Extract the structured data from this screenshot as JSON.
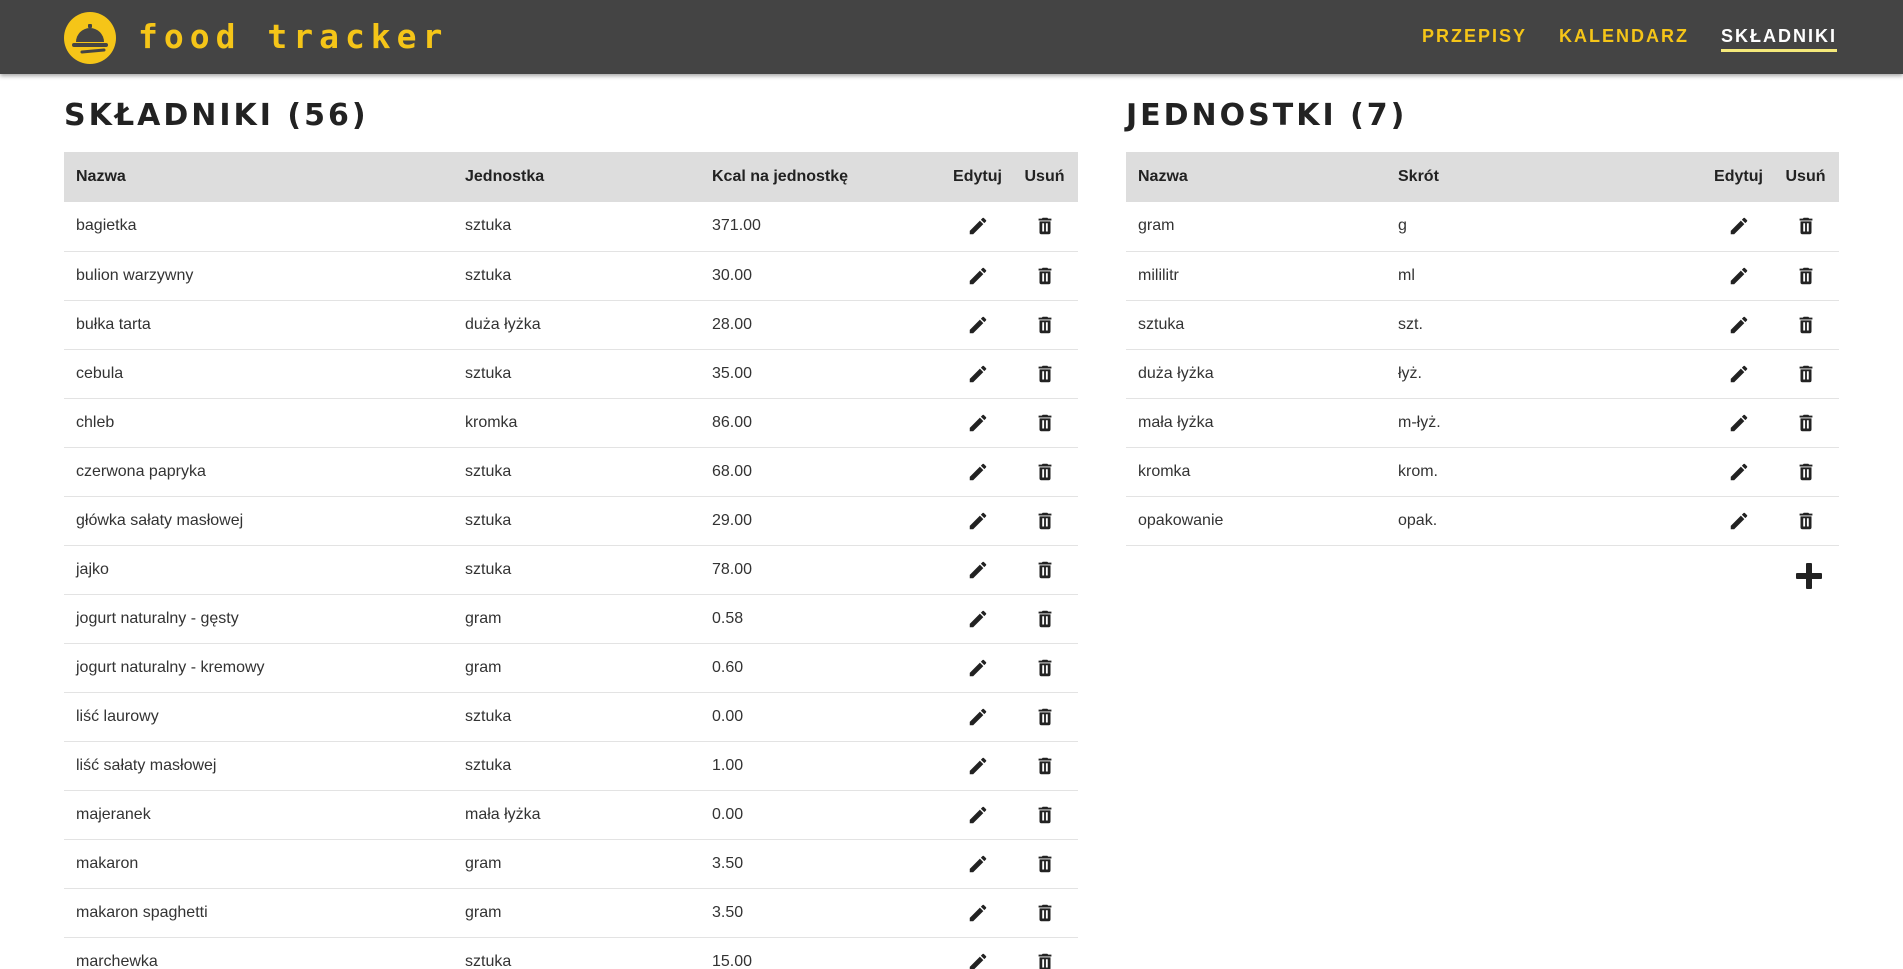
{
  "app": {
    "brand": "food tracker"
  },
  "nav": {
    "items": [
      {
        "label": "PRZEPISY",
        "active": false
      },
      {
        "label": "KALENDARZ",
        "active": false
      },
      {
        "label": "SKŁADNIKI",
        "active": true
      }
    ]
  },
  "ingredients": {
    "title": "SKŁADNIKI (56)",
    "headers": {
      "name": "Nazwa",
      "unit": "Jednostka",
      "kcal": "Kcal na jednostkę",
      "edit": "Edytuj",
      "delete": "Usuń"
    },
    "rows": [
      {
        "name": "bagietka",
        "unit": "sztuka",
        "kcal": "371.00"
      },
      {
        "name": "bulion warzywny",
        "unit": "sztuka",
        "kcal": "30.00"
      },
      {
        "name": "bułka tarta",
        "unit": "duża łyżka",
        "kcal": "28.00"
      },
      {
        "name": "cebula",
        "unit": "sztuka",
        "kcal": "35.00"
      },
      {
        "name": "chleb",
        "unit": "kromka",
        "kcal": "86.00"
      },
      {
        "name": "czerwona papryka",
        "unit": "sztuka",
        "kcal": "68.00"
      },
      {
        "name": "główka sałaty masłowej",
        "unit": "sztuka",
        "kcal": "29.00"
      },
      {
        "name": "jajko",
        "unit": "sztuka",
        "kcal": "78.00"
      },
      {
        "name": "jogurt naturalny - gęsty",
        "unit": "gram",
        "kcal": "0.58"
      },
      {
        "name": "jogurt naturalny - kremowy",
        "unit": "gram",
        "kcal": "0.60"
      },
      {
        "name": "liść laurowy",
        "unit": "sztuka",
        "kcal": "0.00"
      },
      {
        "name": "liść sałaty masłowej",
        "unit": "sztuka",
        "kcal": "1.00"
      },
      {
        "name": "majeranek",
        "unit": "mała łyżka",
        "kcal": "0.00"
      },
      {
        "name": "makaron",
        "unit": "gram",
        "kcal": "3.50"
      },
      {
        "name": "makaron spaghetti",
        "unit": "gram",
        "kcal": "3.50"
      },
      {
        "name": "marchewka",
        "unit": "sztuka",
        "kcal": "15.00"
      }
    ]
  },
  "units": {
    "title": "JEDNOSTKI (7)",
    "headers": {
      "name": "Nazwa",
      "short": "Skrót",
      "edit": "Edytuj",
      "delete": "Usuń"
    },
    "rows": [
      {
        "name": "gram",
        "short": "g"
      },
      {
        "name": "mililitr",
        "short": "ml"
      },
      {
        "name": "sztuka",
        "short": "szt."
      },
      {
        "name": "duża łyżka",
        "short": "łyż."
      },
      {
        "name": "mała łyżka",
        "short": "m-łyż."
      },
      {
        "name": "kromka",
        "short": "krom."
      },
      {
        "name": "opakowanie",
        "short": "opak."
      }
    ]
  },
  "icons": {
    "logo": "food-tray-icon",
    "edit": "pencil-icon",
    "delete": "trash-icon",
    "add": "plus-icon"
  },
  "colors": {
    "header_bg": "#444444",
    "accent": "#f5c518",
    "table_header_bg": "#dddddd"
  }
}
